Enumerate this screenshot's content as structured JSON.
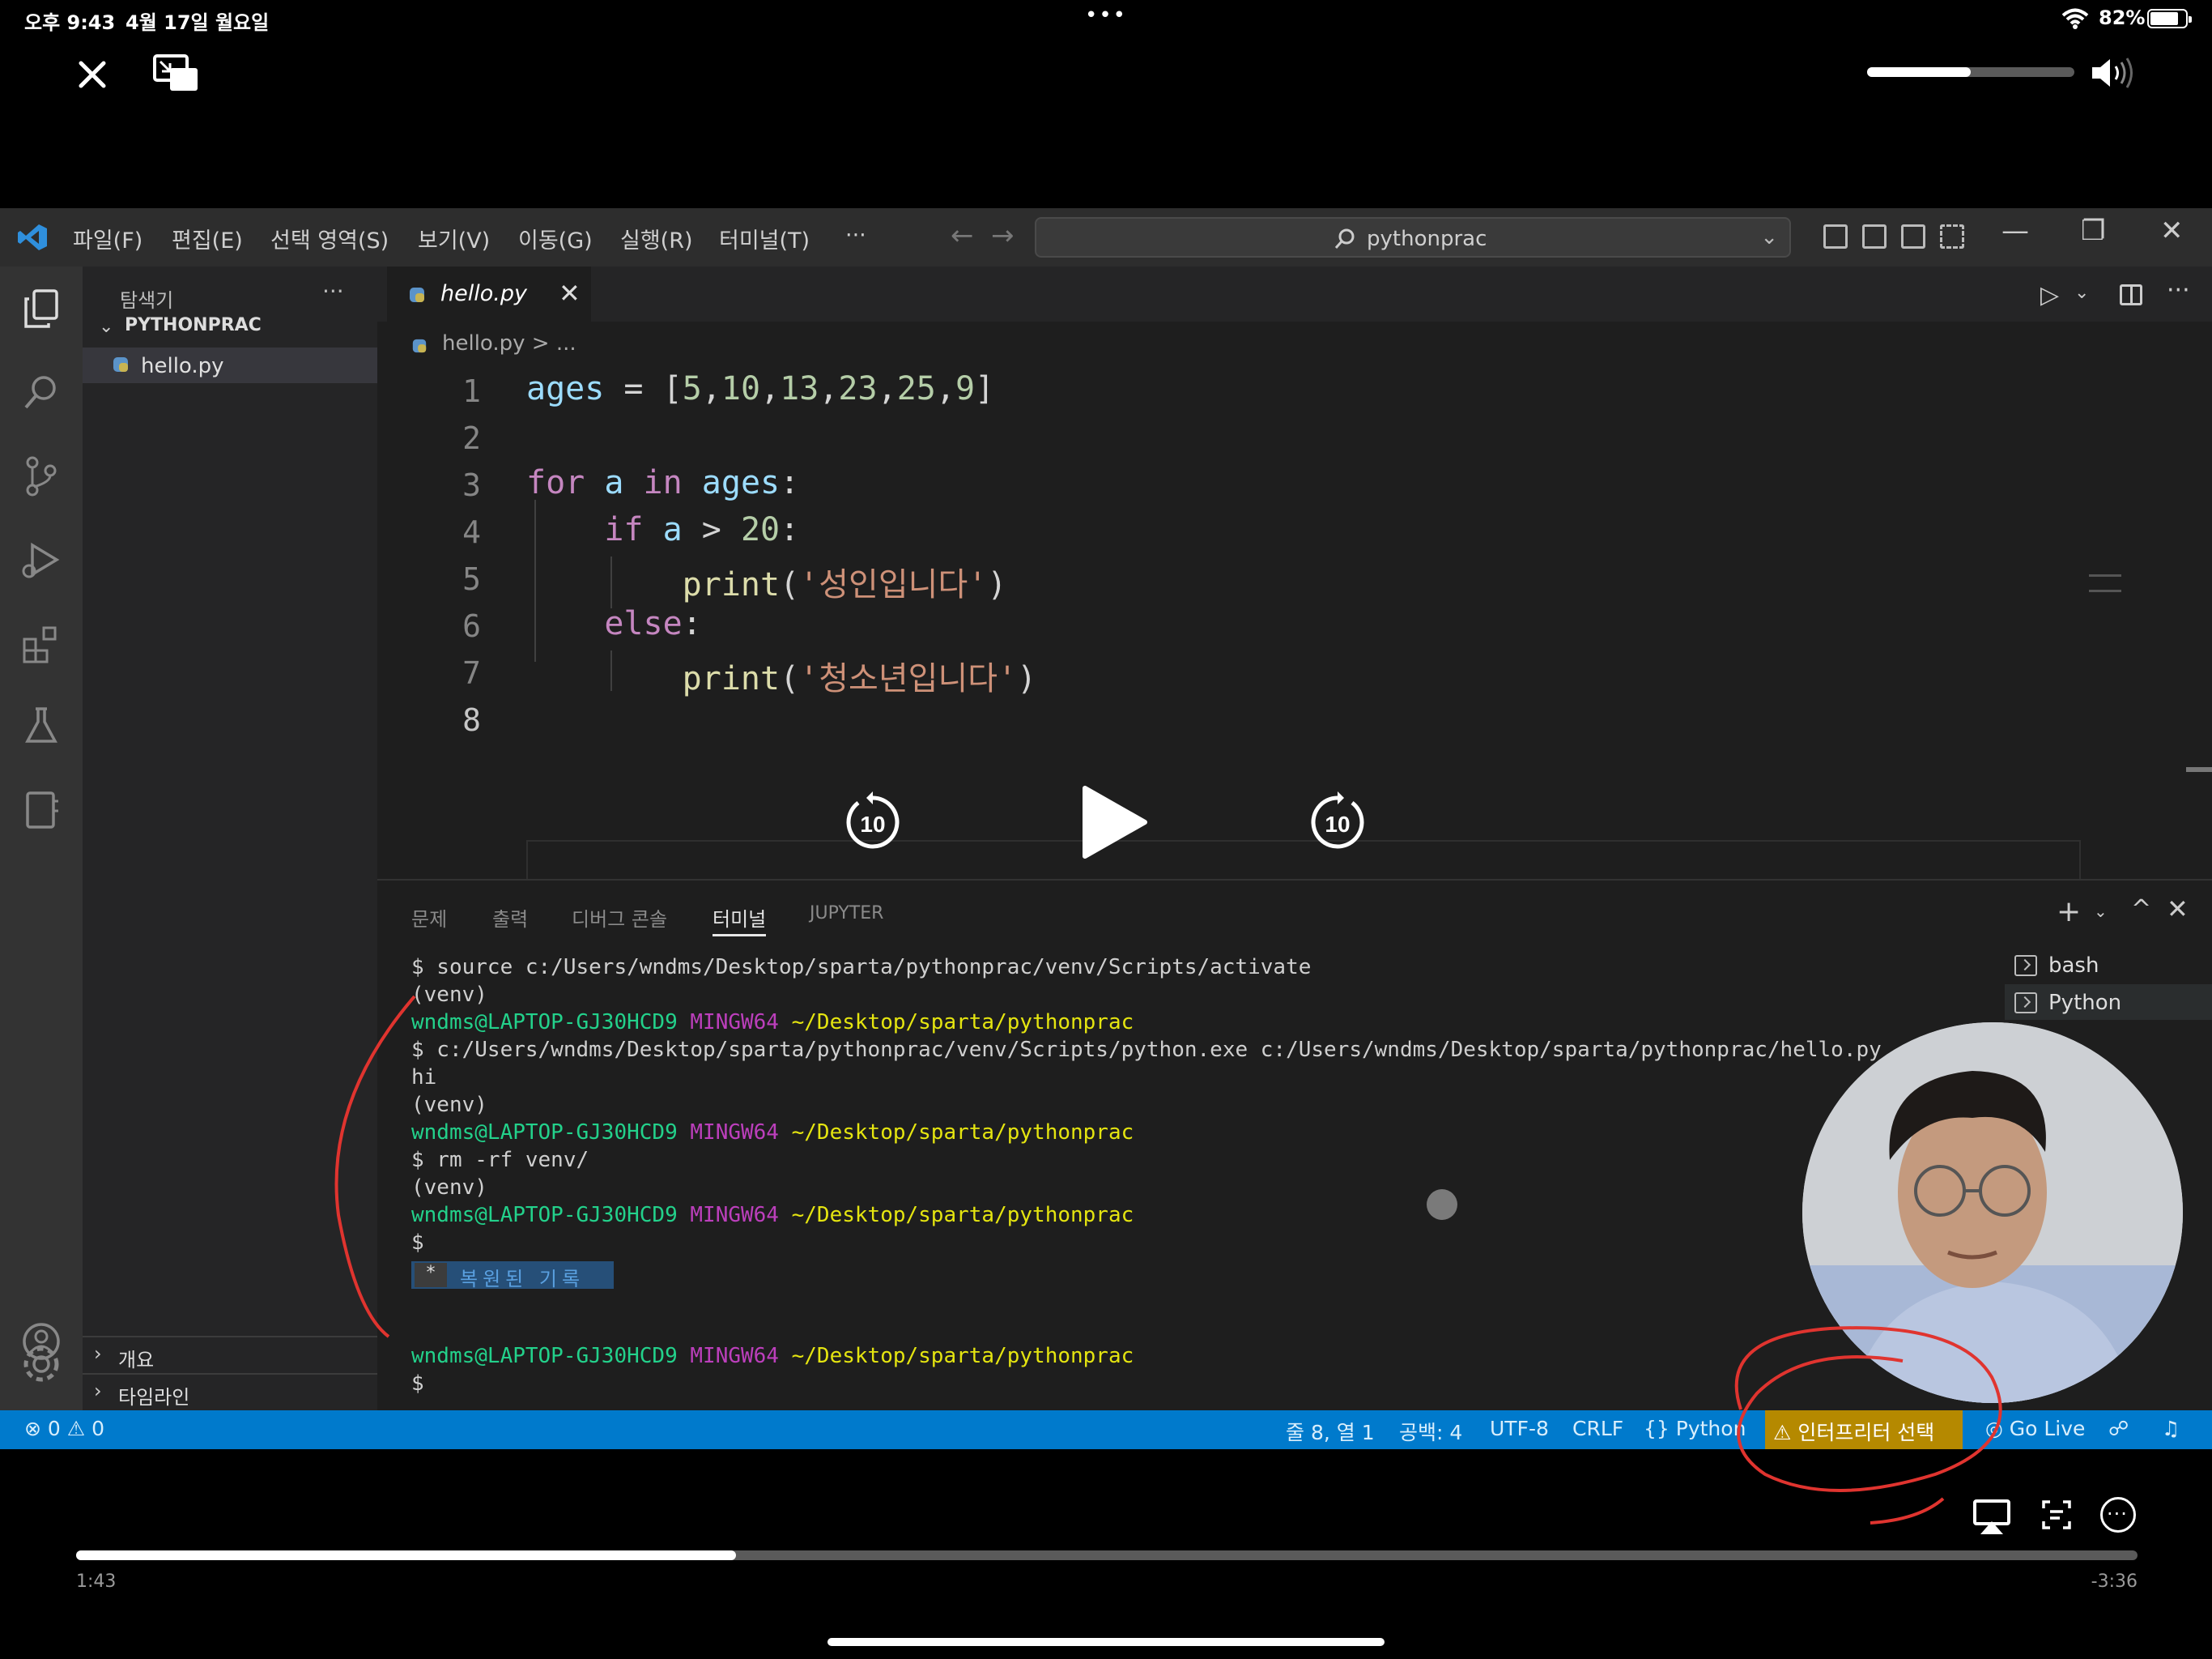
{
  "status_bar": {
    "time": "오후 9:43",
    "date": "4월 17일 월요일",
    "dots": "•••",
    "battery_pct": "82%",
    "battery_level": 0.82
  },
  "player": {
    "volume_level": 0.5,
    "progress": 0.32,
    "time_elapsed": "1:43",
    "time_remaining": "-3:36",
    "skip_back_seconds": "10",
    "skip_forward_seconds": "10"
  },
  "vscode": {
    "menu": [
      "파일(F)",
      "편집(E)",
      "선택 영역(S)",
      "보기(V)",
      "이동(G)",
      "실행(R)",
      "터미널(T)",
      "···"
    ],
    "search_text": "pythonprac",
    "sidebar": {
      "title": "탐색기",
      "more": "···",
      "folder": "PYTHONPRAC",
      "file": "hello.py",
      "outline": "개요",
      "timeline": "타임라인"
    },
    "tab": {
      "label": "hello.py",
      "close": "✕"
    },
    "breadcrumb": "hello.py > ...",
    "code_lines": [
      {
        "num": "1",
        "text": "ages = [5,10,13,23,25,9]"
      },
      {
        "num": "2",
        "text": ""
      },
      {
        "num": "3",
        "text": "for a in ages:"
      },
      {
        "num": "4",
        "text": "    if a > 20:"
      },
      {
        "num": "5",
        "text": "        print('성인입니다')"
      },
      {
        "num": "6",
        "text": "    else:"
      },
      {
        "num": "7",
        "text": "        print('청소년입니다')"
      },
      {
        "num": "8",
        "text": ""
      }
    ],
    "panel_tabs": [
      "문제",
      "출력",
      "디버그 콘솔",
      "터미널",
      "JUPYTER"
    ],
    "terminals": [
      "bash",
      "Python"
    ],
    "terminal_lines": {
      "l1": "$ source c:/Users/wndms/Desktop/sparta/pythonprac/venv/Scripts/activate",
      "l2": "(venv)",
      "user": "wndms@LAPTOP-GJ30HCD9",
      "mingw": "MINGW64",
      "path": "~/Desktop/sparta/pythonprac",
      "l4": "$ c:/Users/wndms/Desktop/sparta/pythonprac/venv/Scripts/python.exe c:/Users/wndms/Desktop/sparta/pythonprac/hello.py",
      "l5": "hi",
      "l6": "(venv)",
      "l8": "$ rm -rf venv/",
      "l9": "(venv)",
      "l11": "$",
      "restored_star": "*",
      "restored": "복원된 기록",
      "l_last": "$"
    },
    "status": {
      "errors": "⊗ 0 ⚠ 0",
      "position": "줄 8, 열 1",
      "spaces": "공백: 4",
      "encoding": "UTF-8",
      "eol": "CRLF",
      "language": "{} Python",
      "interpreter": "⚠ 인터프리터 선택",
      "golive": "◎ Go Live"
    }
  },
  "colors": {
    "accent": "#007acc",
    "interpreter_bg": "#b58900",
    "annotation": "#e0342f"
  }
}
